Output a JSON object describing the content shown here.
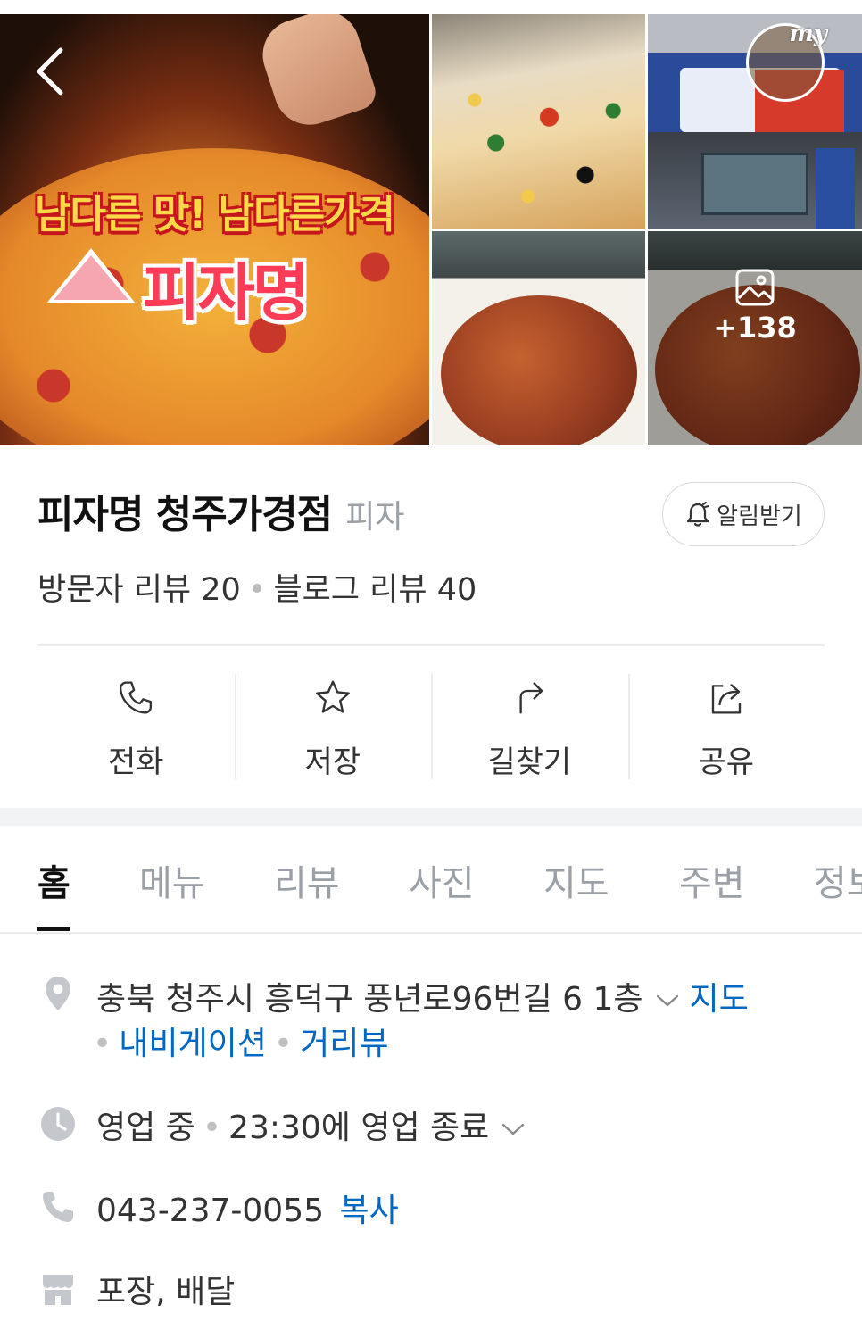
{
  "gallery": {
    "main_banner_top": "남다른 맛! 남다른가격",
    "main_banner_brand": "피자명",
    "my_badge": "my",
    "more_count": "+138"
  },
  "place": {
    "name": "피자명 청주가경점",
    "category": "피자",
    "alarm_label": "알림받기",
    "visitor_review": "방문자 리뷰 20",
    "blog_review": "블로그 리뷰 40"
  },
  "actions": [
    {
      "label": "전화",
      "icon": "phone-icon"
    },
    {
      "label": "저장",
      "icon": "star-icon"
    },
    {
      "label": "길찾기",
      "icon": "directions-icon"
    },
    {
      "label": "공유",
      "icon": "share-icon"
    }
  ],
  "tabs": [
    "홈",
    "메뉴",
    "리뷰",
    "사진",
    "지도",
    "주변",
    "정보"
  ],
  "info": {
    "address": "충북 청주시 흥덕구 풍년로96번길 6 1층",
    "map_link": "지도",
    "navigation_link": "내비게이션",
    "street_view_link": "거리뷰",
    "status": "영업 중",
    "closing": "23:30에 영업 종료",
    "phone": "043-237-0055",
    "copy_label": "복사",
    "services": "포장, 배달"
  },
  "colors": {
    "accent_blue": "#0068c3",
    "icon_gray": "#c4c7cc",
    "divider": "#ececec"
  }
}
